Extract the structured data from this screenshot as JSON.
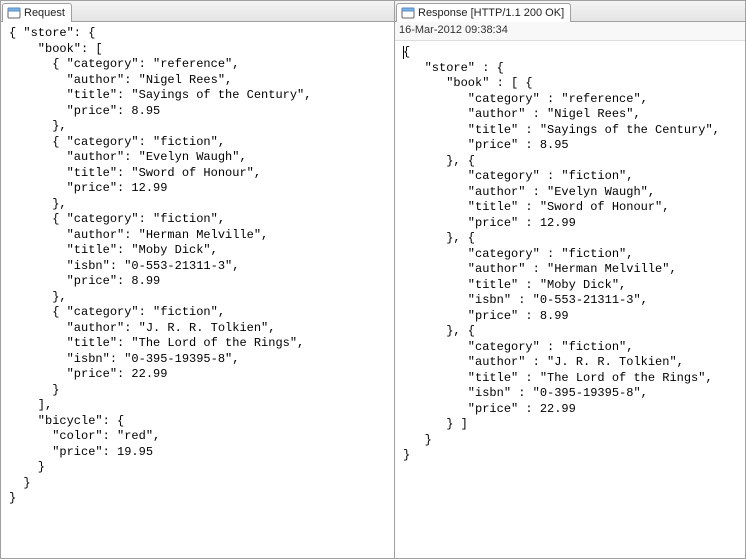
{
  "left_tab": {
    "label": "Request"
  },
  "right_tab": {
    "label": "Response [HTTP/1.1 200 OK]"
  },
  "timestamp": "16-Mar-2012 09:38:34",
  "left_code": "{ \"store\": {\n    \"book\": [ \n      { \"category\": \"reference\",\n        \"author\": \"Nigel Rees\",\n        \"title\": \"Sayings of the Century\",\n        \"price\": 8.95\n      },\n      { \"category\": \"fiction\",\n        \"author\": \"Evelyn Waugh\",\n        \"title\": \"Sword of Honour\",\n        \"price\": 12.99\n      },\n      { \"category\": \"fiction\",\n        \"author\": \"Herman Melville\",\n        \"title\": \"Moby Dick\",\n        \"isbn\": \"0-553-21311-3\",\n        \"price\": 8.99\n      },\n      { \"category\": \"fiction\",\n        \"author\": \"J. R. R. Tolkien\",\n        \"title\": \"The Lord of the Rings\",\n        \"isbn\": \"0-395-19395-8\",\n        \"price\": 22.99\n      }\n    ],\n    \"bicycle\": {\n      \"color\": \"red\",\n      \"price\": 19.95\n    }\n  }\n}",
  "right_code": "{\n   \"store\" : {\n      \"book\" : [ {\n         \"category\" : \"reference\",\n         \"author\" : \"Nigel Rees\",\n         \"title\" : \"Sayings of the Century\",\n         \"price\" : 8.95\n      }, {\n         \"category\" : \"fiction\",\n         \"author\" : \"Evelyn Waugh\",\n         \"title\" : \"Sword of Honour\",\n         \"price\" : 12.99\n      }, {\n         \"category\" : \"fiction\",\n         \"author\" : \"Herman Melville\",\n         \"title\" : \"Moby Dick\",\n         \"isbn\" : \"0-553-21311-3\",\n         \"price\" : 8.99\n      }, {\n         \"category\" : \"fiction\",\n         \"author\" : \"J. R. R. Tolkien\",\n         \"title\" : \"The Lord of the Rings\",\n         \"isbn\" : \"0-395-19395-8\",\n         \"price\" : 22.99\n      } ]\n   }\n}"
}
